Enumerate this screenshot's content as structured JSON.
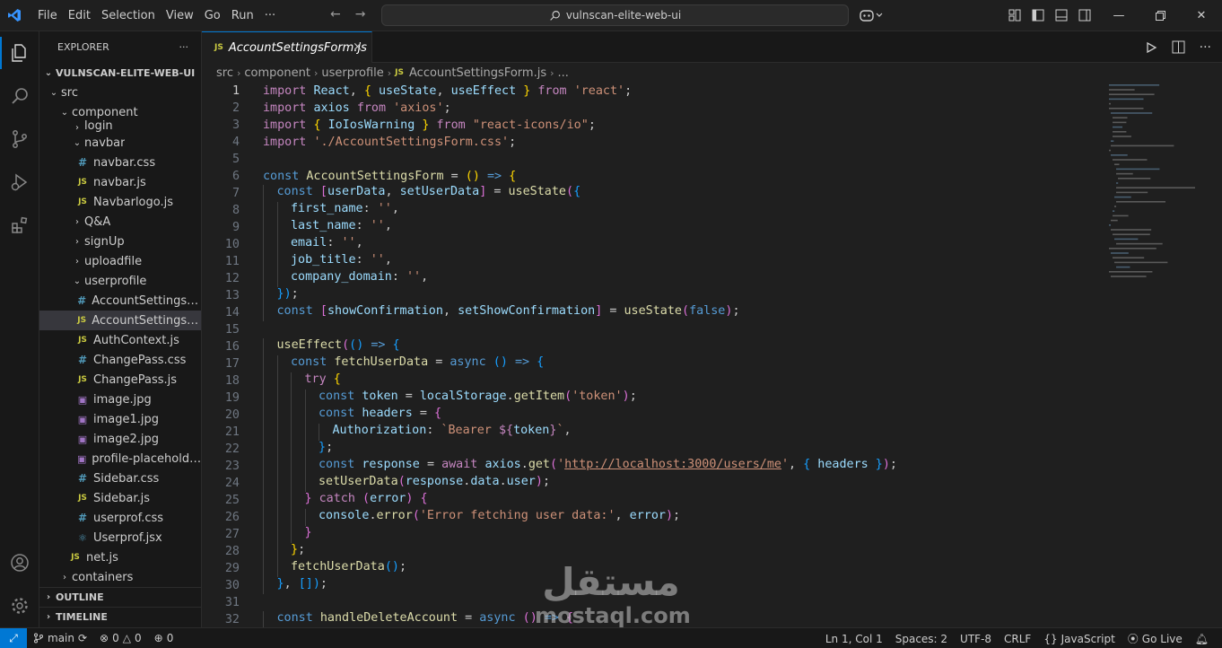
{
  "titlebar": {
    "menu": [
      "File",
      "Edit",
      "Selection",
      "View",
      "Go",
      "Run",
      "···"
    ],
    "search_text": "vulnscan-elite-web-ui"
  },
  "explorer": {
    "title": "EXPLORER",
    "more": "···",
    "root": "VULNSCAN-ELITE-WEB-UI",
    "items": [
      {
        "label": "src",
        "kind": "folder-open"
      },
      {
        "label": "component",
        "kind": "folder-open"
      },
      {
        "label": "login",
        "kind": "folder"
      },
      {
        "label": "navbar",
        "kind": "folder-open"
      },
      {
        "label": "navbar.css",
        "kind": "css"
      },
      {
        "label": "navbar.js",
        "kind": "js"
      },
      {
        "label": "Navbarlogo.js",
        "kind": "js"
      },
      {
        "label": "Q&A",
        "kind": "folder"
      },
      {
        "label": "signUp",
        "kind": "folder"
      },
      {
        "label": "uploadfile",
        "kind": "folder"
      },
      {
        "label": "userprofile",
        "kind": "folder-open"
      },
      {
        "label": "AccountSettingsFor...",
        "kind": "css"
      },
      {
        "label": "AccountSettingsFor...",
        "kind": "js",
        "selected": true
      },
      {
        "label": "AuthContext.js",
        "kind": "js"
      },
      {
        "label": "ChangePass.css",
        "kind": "css"
      },
      {
        "label": "ChangePass.js",
        "kind": "js"
      },
      {
        "label": "image.jpg",
        "kind": "img"
      },
      {
        "label": "image1.jpg",
        "kind": "img"
      },
      {
        "label": "image2.jpg",
        "kind": "img"
      },
      {
        "label": "profile-placeholder....",
        "kind": "img"
      },
      {
        "label": "Sidebar.css",
        "kind": "css"
      },
      {
        "label": "Sidebar.js",
        "kind": "js"
      },
      {
        "label": "userprof.css",
        "kind": "css"
      },
      {
        "label": "Userprof.jsx",
        "kind": "jsx"
      },
      {
        "label": "net.js",
        "kind": "js"
      },
      {
        "label": "containers",
        "kind": "folder"
      }
    ],
    "outline": "OUTLINE",
    "timeline": "TIMELINE"
  },
  "tab": {
    "icon": "JS",
    "label": "AccountSettingsForm.js",
    "close": "×"
  },
  "breadcrumb": [
    "src",
    "component",
    "userprofile",
    "AccountSettingsForm.js",
    "..."
  ],
  "code": {
    "current_line": 1,
    "lines": [
      "import React, { useState, useEffect } from 'react';",
      "import axios from 'axios';",
      "import { IoIosWarning } from \"react-icons/io\";",
      "import './AccountSettingsForm.css';",
      "",
      "const AccountSettingsForm = () => {",
      "  const [userData, setUserData] = useState({",
      "    first_name: '',",
      "    last_name: '',",
      "    email: '',",
      "    job_title: '',",
      "    company_domain: '',",
      "  });",
      "  const [showConfirmation, setShowConfirmation] = useState(false);",
      "",
      "  useEffect(() => {",
      "    const fetchUserData = async () => {",
      "      try {",
      "        const token = localStorage.getItem('token');",
      "        const headers = {",
      "          Authorization: `Bearer ${token}`,",
      "        };",
      "        const response = await axios.get('http://localhost:3000/users/me', { headers });",
      "        setUserData(response.data.user);",
      "      } catch (error) {",
      "        console.error('Error fetching user data:', error);",
      "      }",
      "    };",
      "    fetchUserData();",
      "  }, []);",
      "",
      "  const handleDeleteAccount = async () => {"
    ]
  },
  "watermark": {
    "arabic": "مستقل",
    "latin": "mostaql.com"
  },
  "status": {
    "branch": "main",
    "errors": "0",
    "warnings": "0",
    "ports": "0",
    "position": "Ln 1, Col 1",
    "spaces": "Spaces: 2",
    "encoding": "UTF-8",
    "eol": "CRLF",
    "language": "JavaScript",
    "golive": "Go Live"
  },
  "colors": {
    "accent": "#0078d4",
    "background": "#1f1f1f",
    "sidebar": "#181818"
  }
}
